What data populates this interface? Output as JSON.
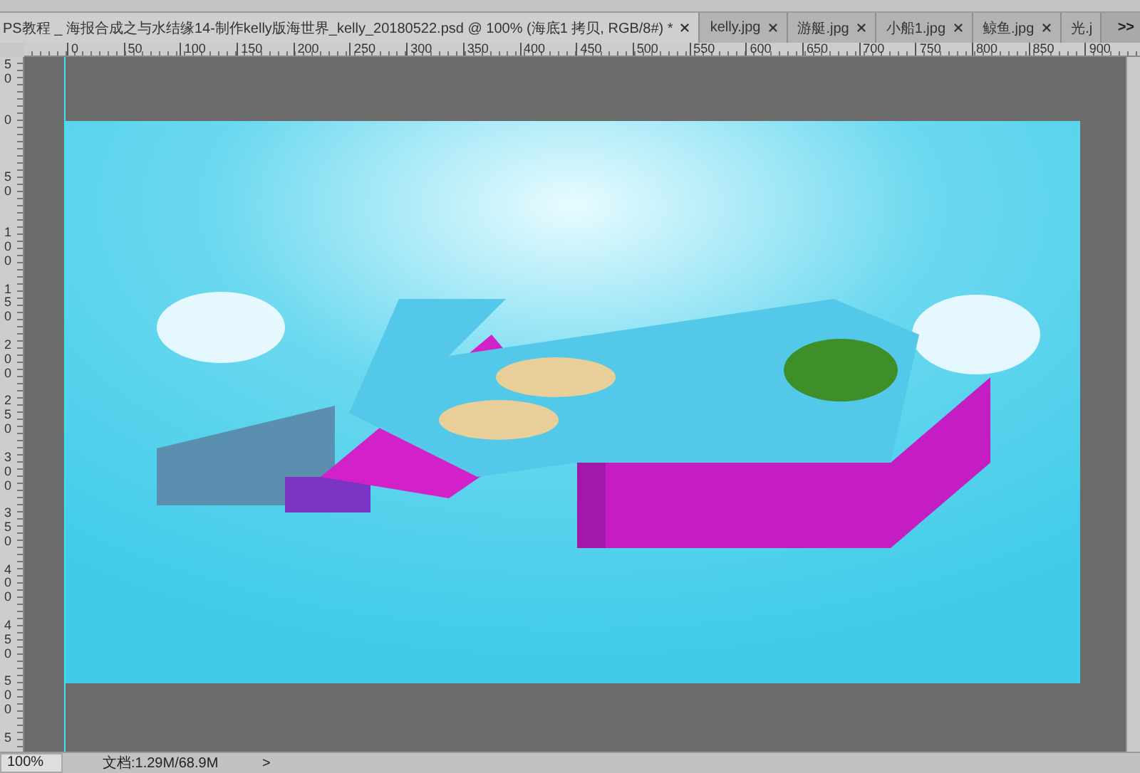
{
  "tabs": [
    {
      "label": "PS教程 _ 海报合成之与水结缘14-制作kelly版海世界_kelly_20180522.psd @ 100% (海底1 拷贝, RGB/8#) *",
      "selected": true
    },
    {
      "label": "kelly.jpg",
      "selected": false
    },
    {
      "label": "游艇.jpg",
      "selected": false
    },
    {
      "label": "小船1.jpg",
      "selected": false
    },
    {
      "label": "鲸鱼.jpg",
      "selected": false
    },
    {
      "label": "光.j",
      "selected": false
    }
  ],
  "tab_overflow": ">>",
  "horizontal_ruler": [
    "0",
    "50",
    "100",
    "150",
    "200",
    "250",
    "300",
    "350",
    "400",
    "450",
    "500",
    "550",
    "600",
    "650",
    "700",
    "750",
    "800",
    "850",
    "900"
  ],
  "vertical_ruler": [
    "50",
    "0",
    "50",
    "100",
    "150",
    "200",
    "250",
    "300",
    "350",
    "400",
    "450",
    "500",
    "5"
  ],
  "status_bar": {
    "zoom": "100%",
    "document_info": "文档:1.29M/68.9M",
    "menu_arrow": ">"
  }
}
